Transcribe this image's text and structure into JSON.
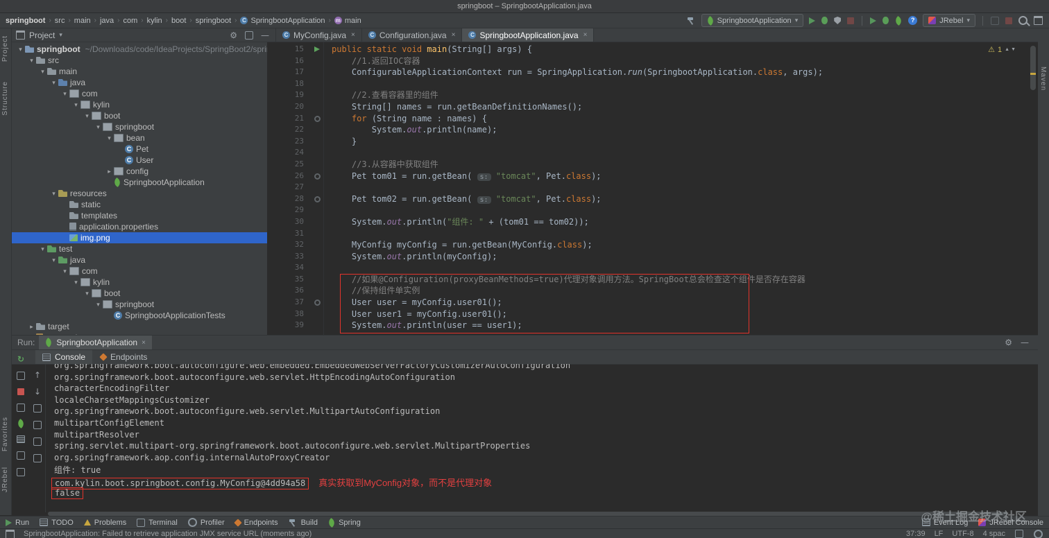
{
  "title_bar": {
    "title": "springboot – SpringbootApplication.java"
  },
  "nav": {
    "breadcrumbs": [
      {
        "label": "springboot"
      },
      {
        "label": "src"
      },
      {
        "label": "main"
      },
      {
        "label": "java"
      },
      {
        "label": "com"
      },
      {
        "label": "kylin"
      },
      {
        "label": "boot"
      },
      {
        "label": "springboot"
      },
      {
        "label": "SpringbootApplication",
        "icon": "class"
      },
      {
        "label": "main",
        "icon": "method"
      }
    ],
    "run_config": "SpringbootApplication",
    "jrebel_label": "JRebel",
    "right_icons": [
      {
        "type": "hammer",
        "name": "build-project-icon"
      },
      {
        "type": "combo-spring",
        "name": "run-configuration-select"
      },
      {
        "type": "play",
        "name": "run-button"
      },
      {
        "type": "bug",
        "name": "debug-button"
      },
      {
        "type": "shield",
        "name": "run-with-coverage-button"
      },
      {
        "type": "stop",
        "name": "stop-button",
        "dim": true
      },
      {
        "type": "sep",
        "name": "separator"
      },
      {
        "type": "play",
        "name": "jrebel-run-button"
      },
      {
        "type": "bug",
        "name": "jrebel-debug-button"
      },
      {
        "type": "leaf",
        "name": "jrebel-agent-icon"
      },
      {
        "type": "helpblue",
        "name": "help-icon"
      },
      {
        "type": "combo-jrebel",
        "name": "jrebel-select"
      },
      {
        "type": "sep",
        "name": "separator"
      },
      {
        "type": "mini",
        "name": "plugin-action-icon",
        "dim": true
      },
      {
        "type": "stop",
        "name": "stop-process-icon",
        "dim": true
      },
      {
        "type": "search",
        "name": "search-everywhere-icon"
      },
      {
        "type": "window",
        "name": "window-controls-icon"
      }
    ]
  },
  "left_strip": {
    "top": [
      "Project",
      "Structure"
    ],
    "bottom": [
      "Favorites",
      "JRebel"
    ]
  },
  "right_strip": {
    "top": [
      "Maven"
    ]
  },
  "project_panel": {
    "header": "Project",
    "header_icons": [
      "settings-icon",
      "collapse-all-icon",
      "hide-icon"
    ],
    "tree": [
      {
        "label": "springboot",
        "suffix": "~/Downloads/code/IdeaProjects/SpringBoot2/springboot",
        "lvl": 0,
        "icon": "project",
        "exp": "open",
        "bold": true
      },
      {
        "label": "src",
        "lvl": 1,
        "icon": "folder",
        "exp": "open"
      },
      {
        "label": "main",
        "lvl": 2,
        "icon": "folder",
        "exp": "open"
      },
      {
        "label": "java",
        "lvl": 3,
        "icon": "src",
        "exp": "open"
      },
      {
        "label": "com",
        "lvl": 4,
        "icon": "pkg",
        "exp": "open"
      },
      {
        "label": "kylin",
        "lvl": 5,
        "icon": "pkg",
        "exp": "open"
      },
      {
        "label": "boot",
        "lvl": 6,
        "icon": "pkg",
        "exp": "open"
      },
      {
        "label": "springboot",
        "lvl": 7,
        "icon": "pkg",
        "exp": "open"
      },
      {
        "label": "bean",
        "lvl": 8,
        "icon": "pkg",
        "exp": "open"
      },
      {
        "label": "Pet",
        "lvl": 9,
        "icon": "class"
      },
      {
        "label": "User",
        "lvl": 9,
        "icon": "class"
      },
      {
        "label": "config",
        "lvl": 8,
        "icon": "pkg",
        "exp": "closed"
      },
      {
        "label": "SpringbootApplication",
        "lvl": 8,
        "icon": "springclass"
      },
      {
        "label": "resources",
        "lvl": 3,
        "icon": "res",
        "exp": "open"
      },
      {
        "label": "static",
        "lvl": 4,
        "icon": "folder"
      },
      {
        "label": "templates",
        "lvl": 4,
        "icon": "folder"
      },
      {
        "label": "application.properties",
        "lvl": 4,
        "icon": "prop"
      },
      {
        "label": "img.png",
        "lvl": 4,
        "icon": "img",
        "selected": true
      },
      {
        "label": "test",
        "lvl": 2,
        "icon": "testfolder",
        "exp": "open"
      },
      {
        "label": "java",
        "lvl": 3,
        "icon": "testsrc",
        "exp": "open"
      },
      {
        "label": "com",
        "lvl": 4,
        "icon": "pkg",
        "exp": "open"
      },
      {
        "label": "kylin",
        "lvl": 5,
        "icon": "pkg",
        "exp": "open"
      },
      {
        "label": "boot",
        "lvl": 6,
        "icon": "pkg",
        "exp": "open"
      },
      {
        "label": "springboot",
        "lvl": 7,
        "icon": "pkg",
        "exp": "open"
      },
      {
        "label": "SpringbootApplicationTests",
        "lvl": 8,
        "icon": "class"
      },
      {
        "label": "target",
        "lvl": 1,
        "icon": "folder",
        "exp": "closed"
      },
      {
        "label": "pom.xml",
        "lvl": 1,
        "icon": "xml"
      }
    ]
  },
  "editor": {
    "tabs": [
      {
        "label": "MyConfig.java"
      },
      {
        "label": "Configuration.java"
      },
      {
        "label": "SpringbootApplication.java",
        "active": true
      }
    ],
    "inspection_count": "1",
    "lines": [
      {
        "n": 15,
        "g": "run",
        "seg": [
          [
            "k",
            "public static void "
          ],
          [
            "m",
            "main"
          ],
          [
            "p",
            "(String[] args) {"
          ]
        ]
      },
      {
        "n": 16,
        "seg": [
          [
            "p",
            "    "
          ],
          [
            "c",
            "//1.返回IOC容器"
          ]
        ]
      },
      {
        "n": 17,
        "seg": [
          [
            "p",
            "    ConfigurableApplicationContext run = SpringApplication."
          ],
          [
            "i",
            "run"
          ],
          [
            "p",
            "(SpringbootApplication."
          ],
          [
            "k",
            "class"
          ],
          [
            "p",
            ", args);"
          ]
        ]
      },
      {
        "n": 18,
        "seg": []
      },
      {
        "n": 19,
        "seg": [
          [
            "p",
            "    "
          ],
          [
            "c",
            "//2.查看容器里的组件"
          ]
        ]
      },
      {
        "n": 20,
        "seg": [
          [
            "p",
            "    String[] names = run.getBeanDefinitionNames();"
          ]
        ]
      },
      {
        "n": 21,
        "g": "dot",
        "seg": [
          [
            "p",
            "    "
          ],
          [
            "k",
            "for"
          ],
          [
            "p",
            " (String name : names) {"
          ]
        ]
      },
      {
        "n": 22,
        "seg": [
          [
            "p",
            "        System."
          ],
          [
            "f",
            "out"
          ],
          [
            "p",
            ".println(name);"
          ]
        ]
      },
      {
        "n": 23,
        "seg": [
          [
            "p",
            "    }"
          ]
        ]
      },
      {
        "n": 24,
        "seg": []
      },
      {
        "n": 25,
        "seg": [
          [
            "p",
            "    "
          ],
          [
            "c",
            "//3.从容器中获取组件"
          ]
        ]
      },
      {
        "n": 26,
        "g": "dot",
        "seg": [
          [
            "p",
            "    Pet tom01 = run.getBean( "
          ],
          [
            "h",
            "s:"
          ],
          [
            "p",
            " "
          ],
          [
            "s",
            "\"tomcat\""
          ],
          [
            "p",
            ", Pet."
          ],
          [
            "k",
            "class"
          ],
          [
            "p",
            ");"
          ]
        ]
      },
      {
        "n": 27,
        "seg": []
      },
      {
        "n": 28,
        "g": "dot",
        "seg": [
          [
            "p",
            "    Pet tom02 = run.getBean( "
          ],
          [
            "h",
            "s:"
          ],
          [
            "p",
            " "
          ],
          [
            "s",
            "\"tomcat\""
          ],
          [
            "p",
            ", Pet."
          ],
          [
            "k",
            "class"
          ],
          [
            "p",
            ");"
          ]
        ]
      },
      {
        "n": 29,
        "seg": []
      },
      {
        "n": 30,
        "seg": [
          [
            "p",
            "    System."
          ],
          [
            "f",
            "out"
          ],
          [
            "p",
            ".println("
          ],
          [
            "s",
            "\"组件: \""
          ],
          [
            "p",
            " + (tom01 == tom02));"
          ]
        ]
      },
      {
        "n": 31,
        "seg": []
      },
      {
        "n": 32,
        "seg": [
          [
            "p",
            "    MyConfig myConfig = run.getBean(MyConfig."
          ],
          [
            "k",
            "class"
          ],
          [
            "p",
            ");"
          ]
        ]
      },
      {
        "n": 33,
        "seg": [
          [
            "p",
            "    System."
          ],
          [
            "f",
            "out"
          ],
          [
            "p",
            ".println(myConfig);"
          ]
        ]
      },
      {
        "n": 34,
        "seg": []
      },
      {
        "n": 35,
        "seg": [
          [
            "p",
            "    "
          ],
          [
            "c",
            "//如果@Configuration(proxyBeanMethods=true)代理对象调用方法。SpringBoot总会检查这个组件是否存在容器"
          ]
        ]
      },
      {
        "n": 36,
        "seg": [
          [
            "p",
            "    "
          ],
          [
            "c",
            "//保持组件单实例"
          ]
        ]
      },
      {
        "n": 37,
        "g": "dot",
        "seg": [
          [
            "p",
            "    User user = myConfig.user01();"
          ]
        ]
      },
      {
        "n": 38,
        "seg": [
          [
            "p",
            "    User user1 = myConfig.user01();"
          ]
        ]
      },
      {
        "n": 39,
        "seg": [
          [
            "p",
            "    System."
          ],
          [
            "f",
            "out"
          ],
          [
            "p",
            ".println(user == user1);"
          ]
        ]
      }
    ]
  },
  "run_panel": {
    "label": "Run:",
    "tab": "SpringbootApplication",
    "header_icons": [
      "settings-icon",
      "hide-icon"
    ],
    "view_tabs": [
      {
        "label": "Console",
        "icon": "console",
        "active": true
      },
      {
        "label": "Endpoints",
        "icon": "endpoints"
      }
    ],
    "toolbar_icons_primary": [
      "rerun",
      "settings",
      "stop",
      "layout",
      "spring-debug",
      "console",
      "print",
      "trash"
    ],
    "toolbar_icons_secondary": [
      "up-arrow",
      "down-arrow",
      "expand-all",
      "collapse-all",
      "soft-wrap",
      "clear-all"
    ],
    "console_lines": [
      {
        "text": "org.springframework.boot.autoconfigure.web.embedded.EmbeddedWebServerFactoryCustomizerAutoConfiguration",
        "clip": true
      },
      {
        "text": "org.springframework.boot.autoconfigure.web.servlet.HttpEncodingAutoConfiguration"
      },
      {
        "text": "characterEncodingFilter"
      },
      {
        "text": "localeCharsetMappingsCustomizer"
      },
      {
        "text": "org.springframework.boot.autoconfigure.web.servlet.MultipartAutoConfiguration"
      },
      {
        "text": "multipartConfigElement"
      },
      {
        "text": "multipartResolver"
      },
      {
        "text": "spring.servlet.multipart-org.springframework.boot.autoconfigure.web.servlet.MultipartProperties"
      },
      {
        "text": "org.springframework.aop.config.internalAutoProxyCreator"
      },
      {
        "text": "组件: true"
      },
      {
        "text": "com.kylin.boot.springboot.config.MyConfig@4dd94a58",
        "boxed": true,
        "note": "真实获取到MyConfig对象，而不是代理对象"
      },
      {
        "text": "false",
        "boxed": true
      }
    ]
  },
  "bottom_bar": {
    "items": [
      {
        "label": "Run",
        "icon": "run"
      },
      {
        "label": "TODO",
        "icon": "todo"
      },
      {
        "label": "Problems",
        "icon": "problems"
      },
      {
        "label": "Terminal",
        "icon": "terminal"
      },
      {
        "label": "Profiler",
        "icon": "profiler"
      },
      {
        "label": "Endpoints",
        "icon": "endpoints"
      },
      {
        "label": "Build",
        "icon": "build"
      },
      {
        "label": "Spring",
        "icon": "spring"
      }
    ],
    "right_items": [
      {
        "label": "Event Log",
        "icon": "eventlog"
      },
      {
        "label": "JRebel Console",
        "icon": "jrebelc"
      }
    ],
    "watermark": "@稀土掘金技术社区"
  },
  "status_bar": {
    "message": "SpringbootApplication: Failed to retrieve application JMX service URL (moments ago)",
    "position": "37:39",
    "line_sep": "LF",
    "encoding": "UTF-8",
    "indent": "4 spac",
    "icons": [
      "lock-icon",
      "indicator-icon"
    ]
  },
  "colors": {
    "accent_selection": "#2f65ca",
    "annotation_red": "#e3342c",
    "keyword_orange": "#cc7832",
    "string_green": "#6a8759",
    "panel_bg": "#3c3f41",
    "editor_bg": "#2b2b2b"
  }
}
